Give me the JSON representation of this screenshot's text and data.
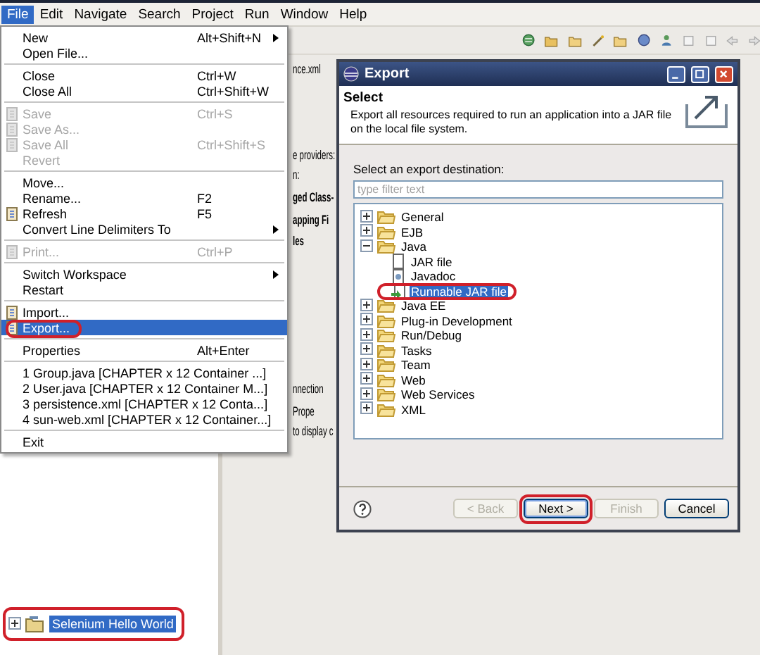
{
  "menu_bar": [
    {
      "label": "File",
      "selected": true
    },
    {
      "label": "Edit",
      "selected": false
    },
    {
      "label": "Navigate",
      "selected": false
    },
    {
      "label": "Search",
      "selected": false
    },
    {
      "label": "Project",
      "selected": false
    },
    {
      "label": "Run",
      "selected": false
    },
    {
      "label": "Window",
      "selected": false
    },
    {
      "label": "Help",
      "selected": false
    }
  ],
  "file_menu": [
    {
      "kind": "item",
      "label": "New",
      "shortcut": "Alt+Shift+N",
      "submenu": true,
      "disabled": false,
      "selected": false
    },
    {
      "kind": "item",
      "label": "Open File...",
      "disabled": false,
      "selected": false
    },
    {
      "kind": "separator"
    },
    {
      "kind": "item",
      "label": "Close",
      "shortcut": "Ctrl+W",
      "disabled": false,
      "selected": false
    },
    {
      "kind": "item",
      "label": "Close All",
      "shortcut": "Ctrl+Shift+W",
      "disabled": false,
      "selected": false
    },
    {
      "kind": "separator"
    },
    {
      "kind": "item",
      "label": "Save",
      "shortcut": "Ctrl+S",
      "has_icon": true,
      "disabled": true,
      "selected": false
    },
    {
      "kind": "item",
      "label": "Save As...",
      "has_icon": true,
      "disabled": true,
      "selected": false
    },
    {
      "kind": "item",
      "label": "Save All",
      "shortcut": "Ctrl+Shift+S",
      "has_icon": true,
      "disabled": true,
      "selected": false
    },
    {
      "kind": "item",
      "label": "Revert",
      "disabled": true,
      "selected": false
    },
    {
      "kind": "separator"
    },
    {
      "kind": "item",
      "label": "Move...",
      "disabled": false,
      "selected": false
    },
    {
      "kind": "item",
      "label": "Rename...",
      "shortcut": "F2",
      "disabled": false,
      "selected": false
    },
    {
      "kind": "item",
      "label": "Refresh",
      "shortcut": "F5",
      "has_icon": true,
      "disabled": false,
      "selected": false
    },
    {
      "kind": "item",
      "label": "Convert Line Delimiters To",
      "submenu": true,
      "disabled": false,
      "selected": false
    },
    {
      "kind": "separator"
    },
    {
      "kind": "item",
      "label": "Print...",
      "shortcut": "Ctrl+P",
      "has_icon": true,
      "disabled": true,
      "selected": false
    },
    {
      "kind": "separator"
    },
    {
      "kind": "item",
      "label": "Switch Workspace",
      "submenu": true,
      "disabled": false,
      "selected": false
    },
    {
      "kind": "item",
      "label": "Restart",
      "disabled": false,
      "selected": false
    },
    {
      "kind": "separator"
    },
    {
      "kind": "item",
      "label": "Import...",
      "has_icon": true,
      "disabled": false,
      "selected": false
    },
    {
      "kind": "item",
      "label": "Export...",
      "has_icon": true,
      "disabled": false,
      "selected": true,
      "circled": true
    },
    {
      "kind": "separator"
    },
    {
      "kind": "item",
      "label": "Properties",
      "shortcut": "Alt+Enter",
      "disabled": false,
      "selected": false
    },
    {
      "kind": "separator"
    },
    {
      "kind": "item",
      "label": "1 Group.java  [CHAPTER x 12 Container ...]",
      "disabled": false,
      "selected": false
    },
    {
      "kind": "item",
      "label": "2 User.java  [CHAPTER x 12 Container M...]",
      "disabled": false,
      "selected": false
    },
    {
      "kind": "item",
      "label": "3 persistence.xml  [CHAPTER x 12 Conta...]",
      "disabled": false,
      "selected": false
    },
    {
      "kind": "item",
      "label": "4 sun-web.xml  [CHAPTER x 12 Container...]",
      "disabled": false,
      "selected": false
    },
    {
      "kind": "separator"
    },
    {
      "kind": "item",
      "label": "Exit",
      "disabled": false,
      "selected": false
    }
  ],
  "explorer": {
    "items": [
      {
        "label": "Selenium Hello World",
        "selected": true,
        "expanded": false,
        "circled": true
      }
    ]
  },
  "editor": {
    "tab": "nce.xml",
    "lines": [
      {
        "kind": "text",
        "text": "e providers:"
      },
      {
        "kind": "text",
        "text": "n:"
      },
      {
        "kind": "section",
        "text": "ged Class-"
      },
      {
        "kind": "heading",
        "text": "apping Fi"
      },
      {
        "kind": "heading",
        "text": "les"
      }
    ]
  },
  "bottom_panel": {
    "tab": "nnection",
    "view": "Prope",
    "message": "to display c"
  },
  "dialog": {
    "title": "Export",
    "header": "Select",
    "description": "Export all resources required to run an application into a JAR file on the local file system.",
    "prompt": "Select an export destination:",
    "filter": {
      "placeholder": "type filter text"
    },
    "tree": [
      {
        "label": "General",
        "expanded": false,
        "selected": false
      },
      {
        "label": "EJB",
        "expanded": false,
        "selected": false
      },
      {
        "label": "Java",
        "expanded": true,
        "selected": false,
        "children": [
          {
            "label": "JAR file",
            "kind": "jar",
            "selected": false
          },
          {
            "label": "Javadoc",
            "kind": "javadoc",
            "selected": false
          },
          {
            "label": "Runnable JAR file",
            "kind": "runnable",
            "selected": true,
            "circled": true
          }
        ]
      },
      {
        "label": "Java EE",
        "expanded": false,
        "selected": false
      },
      {
        "label": "Plug-in Development",
        "expanded": false,
        "selected": false
      },
      {
        "label": "Run/Debug",
        "expanded": false,
        "selected": false
      },
      {
        "label": "Tasks",
        "expanded": false,
        "selected": false
      },
      {
        "label": "Team",
        "expanded": false,
        "selected": false
      },
      {
        "label": "Web",
        "expanded": false,
        "selected": false
      },
      {
        "label": "Web Services",
        "expanded": false,
        "selected": false
      },
      {
        "label": "XML",
        "expanded": false,
        "selected": false
      }
    ],
    "buttons": [
      {
        "label": "< Back",
        "disabled": true,
        "default": false
      },
      {
        "label": "Next >",
        "disabled": false,
        "default": true,
        "circled": true
      },
      {
        "label": "Finish",
        "disabled": true,
        "default": false
      },
      {
        "label": "Cancel",
        "disabled": false,
        "default": false
      }
    ]
  }
}
